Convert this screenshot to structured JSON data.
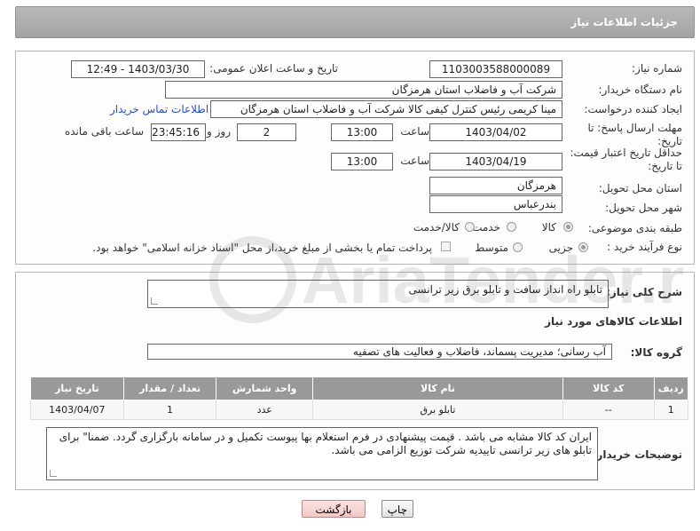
{
  "header": {
    "title": "جزئیات اطلاعات نیاز"
  },
  "form": {
    "need_number_label": "شماره نیاز:",
    "need_number": "1103003588000089",
    "announce_label": "تاریخ و ساعت اعلان عمومی:",
    "announce_value": "1403/03/30 - 12:49",
    "buyer_org_label": "نام دستگاه خریدار:",
    "buyer_org": "شرکت آب و فاضلاب استان هرمزگان",
    "creator_label": "ایجاد کننده درخواست:",
    "creator": "مینا کریمی رئیس کنترل کیفی کالا شرکت آب و فاضلاب استان هرمزگان",
    "contact_link": "اطلاعات تماس خریدار",
    "reply_deadline_label": "مهلت ارسال پاسخ: تا تاریخ:",
    "reply_date": "1403/04/02",
    "time_label": "ساعت",
    "reply_time": "13:00",
    "days_value": "2",
    "days_label": "روز و",
    "remaining_time": "23:45:16",
    "remaining_label": "ساعت باقی مانده",
    "price_deadline_label": "حداقل تاریخ اعتبار قیمت: تا تاریخ:",
    "price_date": "1403/04/19",
    "price_time": "13:00",
    "province_label": "استان محل تحویل:",
    "province": "هرمزگان",
    "city_label": "شهر محل تحویل:",
    "city": "بندرعباس",
    "category_label": "طبقه بندی موضوعی:",
    "category_options": [
      "کالا",
      "خدمت",
      "کالا/خدمت"
    ],
    "category_selected": "کالا",
    "purchase_type_label": "نوع فرآیند خرید :",
    "purchase_options": [
      "جزیی",
      "متوسط"
    ],
    "purchase_selected": "جزیی",
    "payment_note": "پرداخت تمام یا بخشی از مبلغ خرید،از محل \"اسناد خزانه اسلامی\" خواهد بود."
  },
  "details": {
    "description_label": "شرح کلی نیاز:",
    "description": "تابلو راه انداز سافت و تابلو برق زیر ترانسی",
    "goods_info_title": "اطلاعات کالاهای مورد نیاز",
    "goods_group_label": "گروه کالا:",
    "goods_group": "آب رسانی؛ مدیریت پسماند، فاضلاب و فعالیت های تصفیه",
    "table_headers": [
      "ردیف",
      "کد کالا",
      "نام کالا",
      "واحد شمارش",
      "تعداد / مقدار",
      "تاریخ نیاز"
    ],
    "table_rows": [
      [
        "1",
        "--",
        "تابلو برق",
        "عدد",
        "1",
        "1403/04/07"
      ]
    ],
    "buyer_notes_label": "توضیحات خریدار:",
    "buyer_notes": "ایران کد کالا مشابه می باشد . قیمت پیشنهادی در فرم استعلام بها پیوست تکمیل و در سامانه بارگزاری گردد. ضمنا\" برای تابلو های زیر ترانسی تاییدیه شرکت توزیع الزامی می باشد."
  },
  "buttons": {
    "print": "چاپ",
    "back": "بازگشت"
  },
  "watermark": {
    "text": "AriaTender.net"
  }
}
